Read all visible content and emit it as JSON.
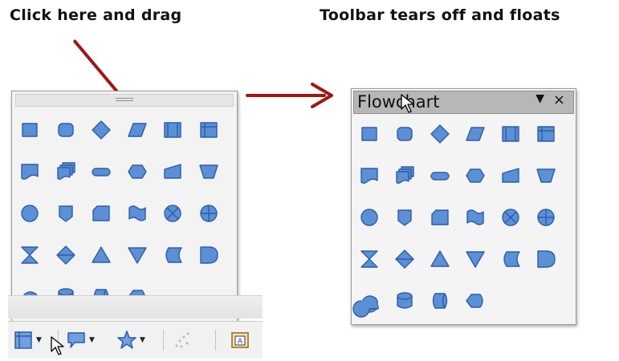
{
  "captions": {
    "left": "Click here and drag",
    "right": "Toolbar tears off and floats"
  },
  "floating_window": {
    "title": "Flowchart",
    "menu_icon": "dropdown-arrow-icon",
    "close_icon": "close-icon",
    "menu_glyph": "▼",
    "close_glyph": "×"
  },
  "flowchart_shapes": [
    "flowchart-process",
    "flowchart-alternate-process",
    "flowchart-decision",
    "flowchart-data",
    "flowchart-predefined-process",
    "flowchart-internal-storage",
    "flowchart-document",
    "flowchart-multidocument",
    "flowchart-terminator",
    "flowchart-preparation",
    "flowchart-manual-input",
    "flowchart-manual-operation",
    "flowchart-connector",
    "flowchart-off-page-connector",
    "flowchart-card",
    "flowchart-punched-tape",
    "flowchart-summing-junction",
    "flowchart-or",
    "flowchart-collate",
    "flowchart-sort",
    "flowchart-extract",
    "flowchart-merge",
    "flowchart-stored-data",
    "flowchart-delay",
    "flowchart-sequential-access",
    "flowchart-magnetic-disc",
    "flowchart-direct-access-storage",
    "flowchart-display"
  ],
  "bottom_toolbar": {
    "items": [
      {
        "icon": "flowchart-icon",
        "dropdown": true
      },
      {
        "icon": "callout-icon",
        "dropdown": true
      },
      {
        "icon": "star-icon",
        "dropdown": true
      },
      {
        "icon": "points-icon",
        "dropdown": false
      },
      {
        "icon": "fontwork-icon",
        "dropdown": false
      }
    ]
  },
  "colors": {
    "shape_fill": "#5b8fd6",
    "shape_stroke": "#2d5ea8",
    "annotation": "#a31515",
    "title_bar": "#b7b7b7"
  }
}
